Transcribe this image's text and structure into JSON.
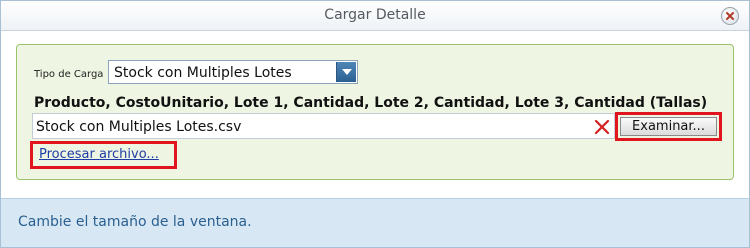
{
  "window": {
    "title": "Cargar Detalle",
    "close_icon": "close-icon"
  },
  "form": {
    "tipo_carga_label": "Tipo de Carga",
    "tipo_carga_value": "Stock con Multiples Lotes",
    "format_description": "Producto, CostoUnitario, Lote 1, Cantidad, Lote 2, Cantidad, Lote 3, Cantidad (Tallas)",
    "file_value": "Stock con Multiples Lotes.csv",
    "browse_label": "Examinar...",
    "process_link_label": "Procesar archivo..."
  },
  "status": {
    "text": "Cambie el tamaño de la ventana."
  },
  "colors": {
    "panel_background": "#eef5e2",
    "panel_border": "#9bc36a",
    "highlight_border": "#e1151d",
    "link": "#1f3da6",
    "statusbar_background": "#d7e8f4"
  }
}
